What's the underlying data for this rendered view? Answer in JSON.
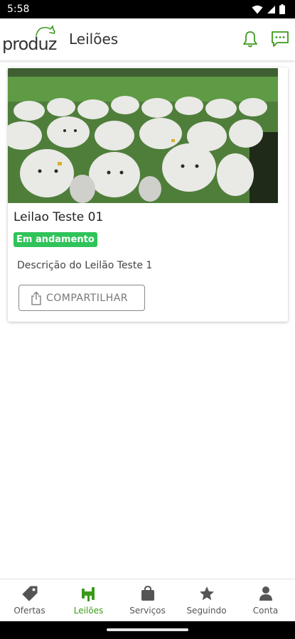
{
  "status_bar": {
    "time": "5:58"
  },
  "app_bar": {
    "logo_text": "produz",
    "title": "Leilões",
    "actions": [
      {
        "icon": "bell-icon"
      },
      {
        "icon": "chat-icon"
      }
    ]
  },
  "auction_card": {
    "image_icon": "cattle-herd-photo",
    "title": "Leilao Teste 01",
    "status": "Em andamento",
    "status_color": "#2fc35a",
    "description": "Descrição do Leilão Teste 1",
    "share_label": "COMPARTILHAR"
  },
  "bottom_nav": {
    "active_color": "#3a9a1a",
    "items": [
      {
        "label": "Ofertas",
        "icon": "tag-icon"
      },
      {
        "label": "Leilões",
        "icon": "gavel-icon",
        "active": true
      },
      {
        "label": "Serviços",
        "icon": "bag-icon"
      },
      {
        "label": "Seguindo",
        "icon": "star-icon"
      },
      {
        "label": "Conta",
        "icon": "person-icon"
      }
    ]
  }
}
